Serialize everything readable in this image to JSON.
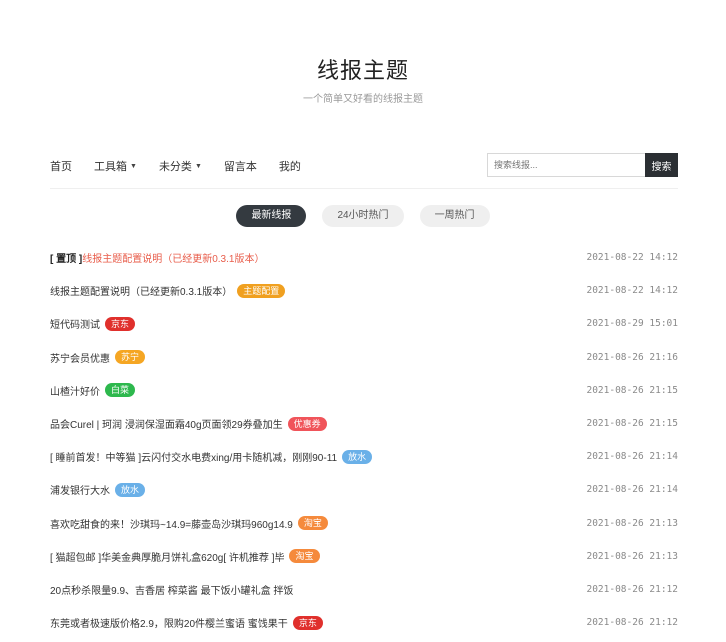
{
  "site": {
    "title": "线报主题",
    "subtitle": "一个简单又好看的线报主题"
  },
  "nav": {
    "items": [
      {
        "label": "首页",
        "dropdown": false
      },
      {
        "label": "工具箱",
        "dropdown": true
      },
      {
        "label": "未分类",
        "dropdown": true
      },
      {
        "label": "留言本",
        "dropdown": false
      },
      {
        "label": "我的",
        "dropdown": false
      }
    ],
    "search": {
      "placeholder": "搜索线报...",
      "button": "搜索"
    }
  },
  "tabs": [
    {
      "label": "最新线报",
      "active": true
    },
    {
      "label": "24小时热门",
      "active": false
    },
    {
      "label": "一周热门",
      "active": false
    }
  ],
  "posts": [
    {
      "pin": "[ 置顶 ]",
      "title": "线报主题配置说明（已经更新0.3.1版本）",
      "badge": "",
      "badge_color": "",
      "time": "2021-08-22 14:12"
    },
    {
      "pin": "",
      "title": "线报主题配置说明（已经更新0.3.1版本）",
      "badge": "主题配置",
      "badge_color": "#f0a020",
      "time": "2021-08-22 14:12"
    },
    {
      "pin": "",
      "title": "短代码测试",
      "badge": "京东",
      "badge_color": "#e0302c",
      "time": "2021-08-29 15:01"
    },
    {
      "pin": "",
      "title": "苏宁会员优惠",
      "badge": "苏宁",
      "badge_color": "#f5a623",
      "time": "2021-08-26 21:16"
    },
    {
      "pin": "",
      "title": "山楂汁好价",
      "badge": "白菜",
      "badge_color": "#2db84d",
      "time": "2021-08-26 21:15"
    },
    {
      "pin": "",
      "title": "品会Curel | 珂润 浸润保湿面霜40g页面领29券叠加生",
      "badge": "优惠券",
      "badge_color": "#f0545a",
      "time": "2021-08-26 21:15"
    },
    {
      "pin": "",
      "title": "[ 睡前首发！中等猫 ]云闪付交水电费xing/用卡随机减，刚刚90-11",
      "badge": "放水",
      "badge_color": "#6ab0e8",
      "time": "2021-08-26 21:14"
    },
    {
      "pin": "",
      "title": "浦发银行大水",
      "badge": "放水",
      "badge_color": "#6ab0e8",
      "time": "2021-08-26 21:14"
    },
    {
      "pin": "",
      "title": "喜欢吃甜食的来！沙琪玛~14.9=藤壶岛沙琪玛960g14.9",
      "badge": "淘宝",
      "badge_color": "#f58a3c",
      "time": "2021-08-26 21:13"
    },
    {
      "pin": "",
      "title": "[ 猫超包邮 ]华美金典厚脆月饼礼盒620g[ 许机推荐 ]毕",
      "badge": "淘宝",
      "badge_color": "#f58a3c",
      "time": "2021-08-26 21:13"
    },
    {
      "pin": "",
      "title": "20点秒杀限量9.9、吉香居 榨菜酱 最下饭小罐礼盒 拌饭",
      "badge": "",
      "badge_color": "",
      "time": "2021-08-26 21:12"
    },
    {
      "pin": "",
      "title": "东莞或者极速版价格2.9，限购20件樱兰蜜语 蜜饯果干",
      "badge": "京东",
      "badge_color": "#e0302c",
      "time": "2021-08-26 21:12"
    }
  ]
}
